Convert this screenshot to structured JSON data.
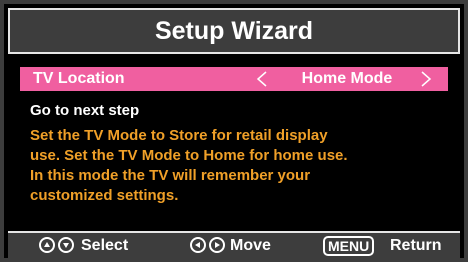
{
  "title": "Setup Wizard",
  "setting": {
    "label": "TV Location",
    "value": "Home Mode"
  },
  "next_step": "Go to next step",
  "description": [
    "Set the TV Mode to Store for retail display",
    "use. Set the TV Mode to Home for home use.",
    "In this mode the TV will remember your",
    "customized settings."
  ],
  "footer": {
    "select_label": "Select",
    "move_label": "Move",
    "menu_key": "MENU",
    "return_label": "Return"
  },
  "colors": {
    "highlight": "#f05fa0",
    "description_text": "#f0a028",
    "panel": "#3d3d3d"
  }
}
